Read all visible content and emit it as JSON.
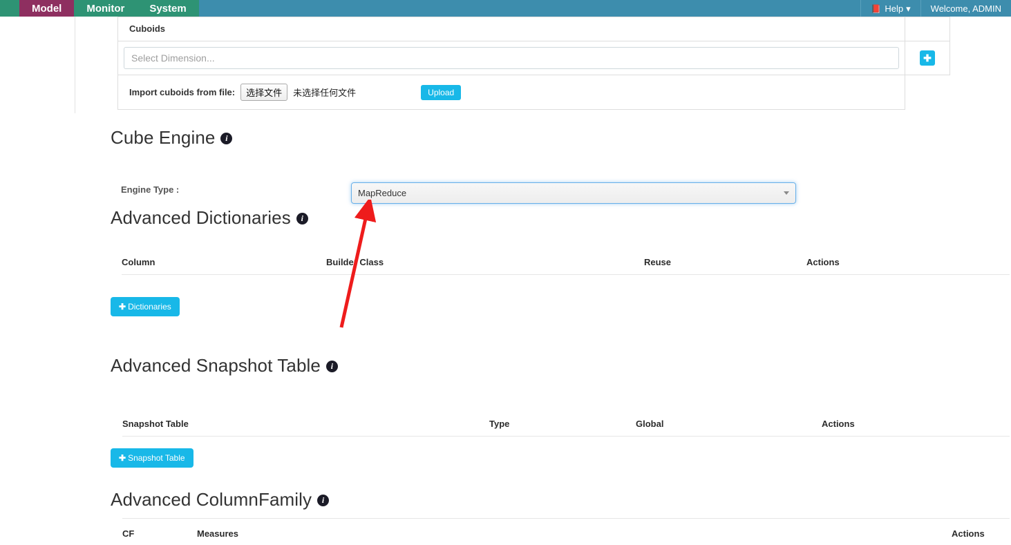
{
  "navbar": {
    "tabs": [
      {
        "label": "Model",
        "active": true
      },
      {
        "label": "Monitor",
        "active": false
      },
      {
        "label": "System",
        "active": false
      }
    ],
    "right_items": [
      {
        "label": "Help",
        "icon": "book-icon",
        "caret": "▾"
      },
      {
        "label": "Welcome, ADMIN",
        "icon": "",
        "caret": ""
      }
    ]
  },
  "cuboids": {
    "title": "Cuboids",
    "dimension_placeholder": "Select Dimension...",
    "dimension_value": "",
    "add_button_glyph": "✚",
    "import_label": "Import cuboids from file:",
    "file_choose_label": "选择文件",
    "file_status": "未选择任何文件",
    "upload_label": "Upload"
  },
  "cube_engine": {
    "heading": "Cube Engine",
    "info_glyph": "i",
    "engine_type_label": "Engine Type :",
    "engine_type_value": "MapReduce",
    "engine_type_options": [
      "MapReduce"
    ]
  },
  "advanced_dictionaries": {
    "heading": "Advanced Dictionaries",
    "info_glyph": "i",
    "columns": [
      "Column",
      "Builder Class",
      "Reuse",
      "Actions"
    ],
    "rows": [],
    "add_button_label": "Dictionaries",
    "add_button_glyph": "✚"
  },
  "advanced_snapshot_table": {
    "heading": "Advanced Snapshot Table",
    "info_glyph": "i",
    "columns": [
      "Snapshot Table",
      "Type",
      "Global",
      "Actions"
    ],
    "rows": [],
    "add_button_label": "Snapshot Table",
    "add_button_glyph": "✚"
  },
  "advanced_columnfamily": {
    "heading": "Advanced ColumnFamily",
    "info_glyph": "i",
    "columns": [
      "CF",
      "Measures",
      "Actions"
    ],
    "rows": []
  },
  "annotation": {
    "type": "arrow",
    "color": "#ee1c1c",
    "points_to": "engine-type-select"
  },
  "colors": {
    "nav_bg": "#3d8dad",
    "nav_tab": "#2e9374",
    "nav_tab_active": "#8e2f60",
    "accent_cyan": "#18b8e8",
    "focus_blue": "#66afe9",
    "heading_text": "#333333"
  }
}
